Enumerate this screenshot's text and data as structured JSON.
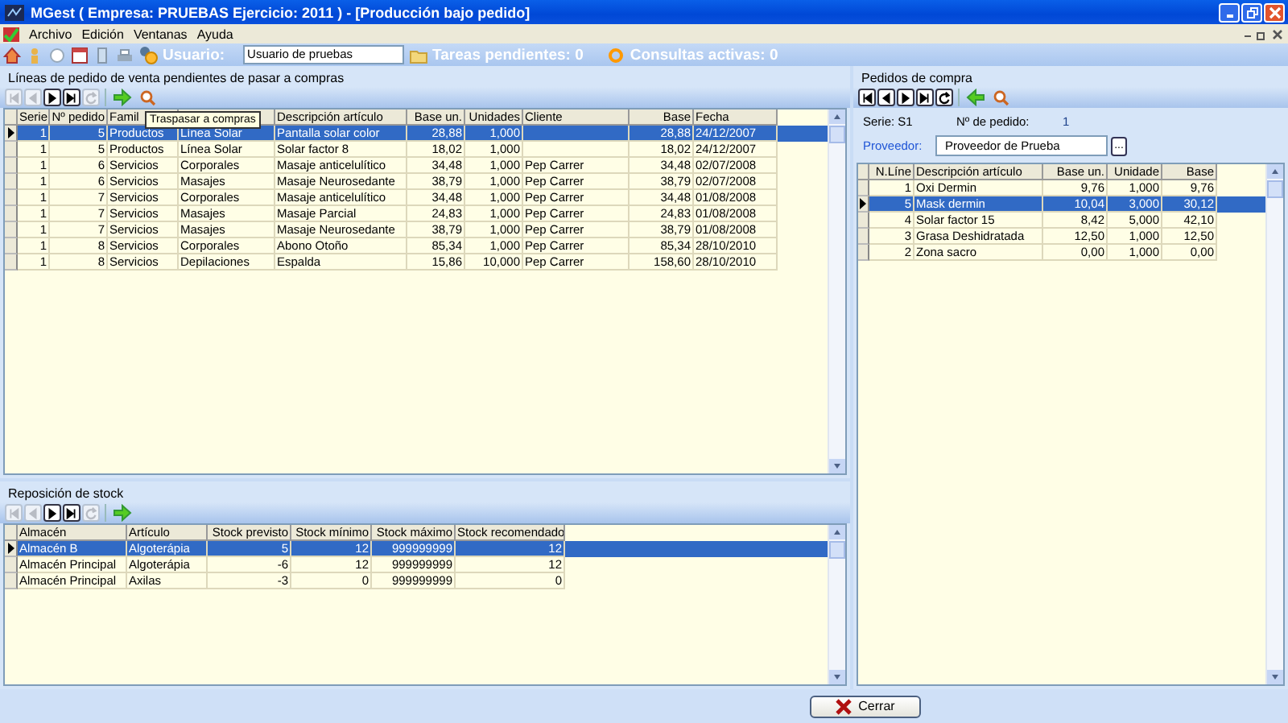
{
  "window": {
    "title": "MGest ( Empresa: PRUEBAS Ejercicio: 2011 ) - [Producción bajo pedido]"
  },
  "menu": [
    "Archivo",
    "Edición",
    "Ventanas",
    "Ayuda"
  ],
  "toolbar": {
    "user_label": "Usuario:",
    "user_value": "Usuario de pruebas",
    "tasks": "Tareas pendientes: 0",
    "queries": "Consultas activas: 0"
  },
  "sales_lines": {
    "title": "Líneas de pedido de venta pendientes de pasar a compras",
    "nav": [
      {
        "kind": "first",
        "disabled": true
      },
      {
        "kind": "prev",
        "disabled": true
      },
      {
        "kind": "next",
        "disabled": false
      },
      {
        "kind": "last",
        "disabled": false
      },
      {
        "kind": "refresh",
        "disabled": true
      }
    ],
    "tooltip": "Traspasar a compras",
    "columns": [
      {
        "label": "Serie"
      },
      {
        "label": "Nº pedido"
      },
      {
        "label": "Famil"
      },
      {},
      {
        "label": "Descripción artículo"
      },
      {
        "label": "Base un."
      },
      {
        "label": "Unidades"
      },
      {
        "label": "Cliente"
      },
      {
        "label": "Base"
      },
      {
        "label": "Fecha"
      }
    ],
    "rows": [
      {
        "selected": true,
        "cells": [
          "1",
          "5",
          "Productos",
          "Línea Solar",
          "Pantalla solar color",
          "28,88",
          "1,000",
          null,
          "28,88",
          "24/12/2007"
        ]
      },
      {
        "selected": false,
        "cells": [
          "1",
          "5",
          "Productos",
          "Línea Solar",
          "Solar factor 8",
          "18,02",
          "1,000",
          null,
          "18,02",
          "24/12/2007"
        ]
      },
      {
        "selected": false,
        "cells": [
          "1",
          "6",
          "Servicios",
          "Corporales",
          "Masaje anticelulítico",
          "34,48",
          "1,000",
          "Pep Carrer",
          "34,48",
          "02/07/2008"
        ]
      },
      {
        "selected": false,
        "cells": [
          "1",
          "6",
          "Servicios",
          "Masajes",
          "Masaje Neurosedante",
          "38,79",
          "1,000",
          "Pep Carrer",
          "38,79",
          "02/07/2008"
        ]
      },
      {
        "selected": false,
        "cells": [
          "1",
          "7",
          "Servicios",
          "Corporales",
          "Masaje anticelulítico",
          "34,48",
          "1,000",
          "Pep Carrer",
          "34,48",
          "01/08/2008"
        ]
      },
      {
        "selected": false,
        "cells": [
          "1",
          "7",
          "Servicios",
          "Masajes",
          "Masaje Parcial",
          "24,83",
          "1,000",
          "Pep Carrer",
          "24,83",
          "01/08/2008"
        ]
      },
      {
        "selected": false,
        "cells": [
          "1",
          "7",
          "Servicios",
          "Masajes",
          "Masaje Neurosedante",
          "38,79",
          "1,000",
          "Pep Carrer",
          "38,79",
          "01/08/2008"
        ]
      },
      {
        "selected": false,
        "cells": [
          "1",
          "8",
          "Servicios",
          "Corporales",
          "Abono Otoño",
          "85,34",
          "1,000",
          "Pep Carrer",
          "85,34",
          "28/10/2010"
        ]
      },
      {
        "selected": false,
        "cells": [
          "1",
          "8",
          "Servicios",
          "Depilaciones",
          "Espalda",
          "15,86",
          "10,000",
          "Pep Carrer",
          "158,60",
          "28/10/2010"
        ]
      }
    ]
  },
  "stock": {
    "title": "Reposición de stock",
    "nav": [
      {
        "kind": "first",
        "disabled": true
      },
      {
        "kind": "prev",
        "disabled": true
      },
      {
        "kind": "next",
        "disabled": false
      },
      {
        "kind": "last",
        "disabled": false
      },
      {
        "kind": "refresh",
        "disabled": true
      }
    ],
    "columns": [
      {
        "label": "Almacén"
      },
      {
        "label": "Artículo"
      },
      {
        "label": "Stock previsto"
      },
      {
        "label": "Stock mínimo"
      },
      {
        "label": "Stock máximo"
      },
      {
        "label": "Stock recomendado"
      }
    ],
    "rows": [
      {
        "selected": true,
        "cells": [
          "Almacén B",
          "Algoterápia",
          "5",
          "12",
          "999999999",
          "12"
        ]
      },
      {
        "selected": false,
        "cells": [
          "Almacén Principal",
          "Algoterápia",
          "-6",
          "12",
          "999999999",
          "12"
        ]
      },
      {
        "selected": false,
        "cells": [
          "Almacén Principal",
          "Axilas",
          "-3",
          "0",
          "999999999",
          "0"
        ]
      }
    ]
  },
  "purchase_orders": {
    "title": "Pedidos de compra",
    "nav": [
      {
        "kind": "first",
        "disabled": false
      },
      {
        "kind": "prev",
        "disabled": false
      },
      {
        "kind": "next",
        "disabled": false
      },
      {
        "kind": "last",
        "disabled": false
      },
      {
        "kind": "refresh",
        "disabled": false
      }
    ],
    "serie": "Serie: S1",
    "order_label": "Nº de pedido:",
    "order_value": "1",
    "supplier_label": "Proveedor:",
    "supplier_value": "Proveedor de Prueba",
    "browse": "...",
    "columns": [
      {
        "label": "N.Líne"
      },
      {
        "label": "Descripción artículo"
      },
      {
        "label": "Base un."
      },
      {
        "label": "Unidade"
      },
      {
        "label": "Base"
      }
    ],
    "rows": [
      {
        "selected": false,
        "cells": [
          "1",
          "Oxi Dermin",
          "9,76",
          "1,000",
          "9,76"
        ]
      },
      {
        "selected": true,
        "cells": [
          "5",
          "Mask dermin",
          "10,04",
          "3,000",
          "30,12"
        ]
      },
      {
        "selected": false,
        "cells": [
          "4",
          "Solar factor 15",
          "8,42",
          "5,000",
          "42,10"
        ]
      },
      {
        "selected": false,
        "cells": [
          "3",
          "Grasa Deshidratada",
          "12,50",
          "1,000",
          "12,50"
        ]
      },
      {
        "selected": false,
        "cells": [
          "2",
          "Zona sacro",
          "0,00",
          "1,000",
          "0,00"
        ]
      }
    ]
  },
  "close_button": "Cerrar"
}
